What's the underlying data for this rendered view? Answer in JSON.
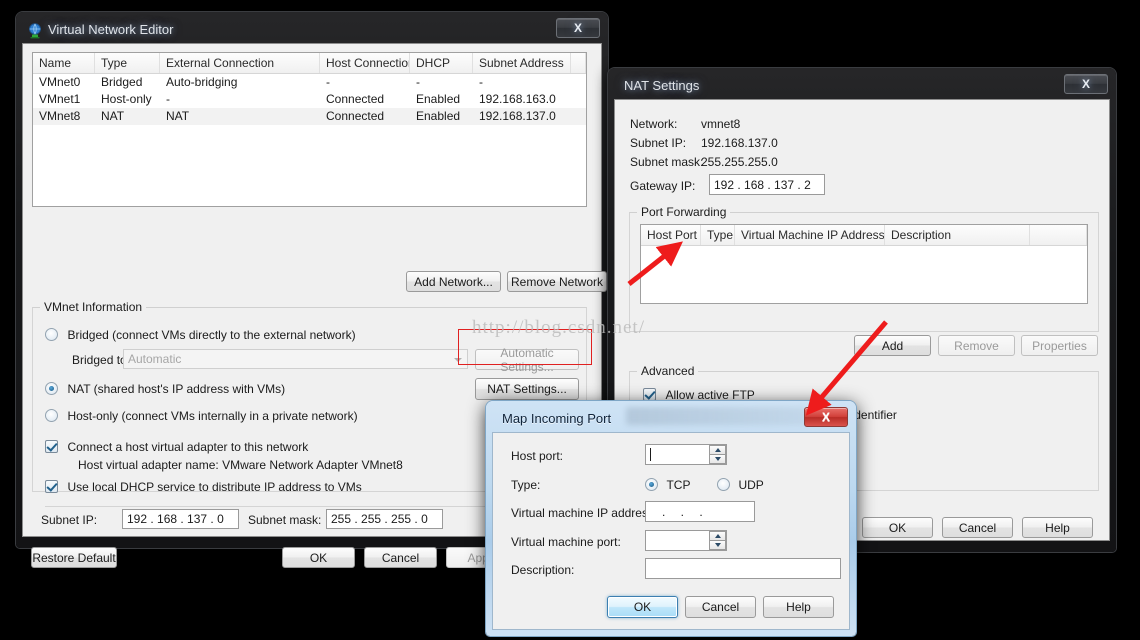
{
  "watermark": "http://blog.csdn.net/",
  "colors": {
    "accent_red": "#e02020",
    "window_bg": "#f0f0f0",
    "title_text": "#dfe3e8"
  },
  "vne": {
    "title": "Virtual Network Editor",
    "close_label": "X",
    "table": {
      "headers": [
        "Name",
        "Type",
        "External Connection",
        "Host Connection",
        "DHCP",
        "Subnet Address"
      ],
      "rows": [
        [
          "VMnet0",
          "Bridged",
          "Auto-bridging",
          "-",
          "-",
          "-"
        ],
        [
          "VMnet1",
          "Host-only",
          "-",
          "Connected",
          "Enabled",
          "192.168.163.0"
        ],
        [
          "VMnet8",
          "NAT",
          "NAT",
          "Connected",
          "Enabled",
          "192.168.137.0"
        ]
      ],
      "selected_row": 2
    },
    "add_network_label": "Add Network...",
    "remove_network_label": "Remove Network",
    "info_group_title": "VMnet Information",
    "radio_bridged_label": "Bridged (connect VMs directly to the external network)",
    "radio_bridged_selected": false,
    "bridged_to_label": "Bridged to:",
    "bridged_to_value": "Automatic",
    "automatic_settings_label": "Automatic Settings...",
    "radio_nat_label": "NAT (shared host's IP address with VMs)",
    "radio_nat_selected": true,
    "nat_settings_label": "NAT Settings...",
    "radio_hostonly_label": "Host-only (connect VMs internally in a private network)",
    "radio_hostonly_selected": false,
    "chk_host_adapter_label": "Connect a host virtual adapter to this network",
    "chk_host_adapter_checked": true,
    "host_adapter_name_label": "Host virtual adapter name: VMware Network Adapter VMnet8",
    "chk_dhcp_label": "Use local DHCP service to distribute IP address to VMs",
    "chk_dhcp_checked": true,
    "subnet_ip_label": "Subnet IP:",
    "subnet_ip_value": "192 . 168 . 137 .  0",
    "subnet_mask_label": "Subnet mask:",
    "subnet_mask_value": "255 . 255 . 255 .  0",
    "restore_default_label": "Restore Default",
    "ok_label": "OK",
    "cancel_label": "Cancel",
    "apply_label": "Apply"
  },
  "nat": {
    "title": "NAT Settings",
    "close_label": "X",
    "network_label": "Network:",
    "network_value": "vmnet8",
    "subnet_ip_label": "Subnet IP:",
    "subnet_ip_value": "192.168.137.0",
    "subnet_mask_label": "Subnet mask:",
    "subnet_mask_value": "255.255.255.0",
    "gateway_ip_label": "Gateway IP:",
    "gateway_ip_value": "192 . 168 . 137 .  2",
    "port_forwarding_title": "Port Forwarding",
    "table": {
      "headers": [
        "Host Port",
        "Type",
        "Virtual Machine IP Address",
        "Description"
      ],
      "rows": []
    },
    "add_label": "Add",
    "remove_label": "Remove",
    "properties_label": "Properties",
    "advanced_title": "Advanced",
    "chk_ftp_label": "Allow active FTP",
    "chk_ftp_checked": true,
    "chk_oui_label": "Allow any Organizationally Unique Identifier",
    "chk_oui_checked": true,
    "ok_label": "OK",
    "cancel_label": "Cancel",
    "help_label": "Help"
  },
  "map_port": {
    "title": "Map Incoming Port",
    "close_label": "X",
    "host_port_label": "Host port:",
    "host_port_value": "",
    "type_label": "Type:",
    "type_tcp_label": "TCP",
    "type_udp_label": "UDP",
    "type_selected": "TCP",
    "vm_ip_label": "Virtual machine IP address:",
    "vm_ip_value": "   .      .      .   ",
    "vm_port_label": "Virtual machine port:",
    "vm_port_value": "",
    "description_label": "Description:",
    "description_value": "",
    "ok_label": "OK",
    "cancel_label": "Cancel",
    "help_label": "Help"
  }
}
